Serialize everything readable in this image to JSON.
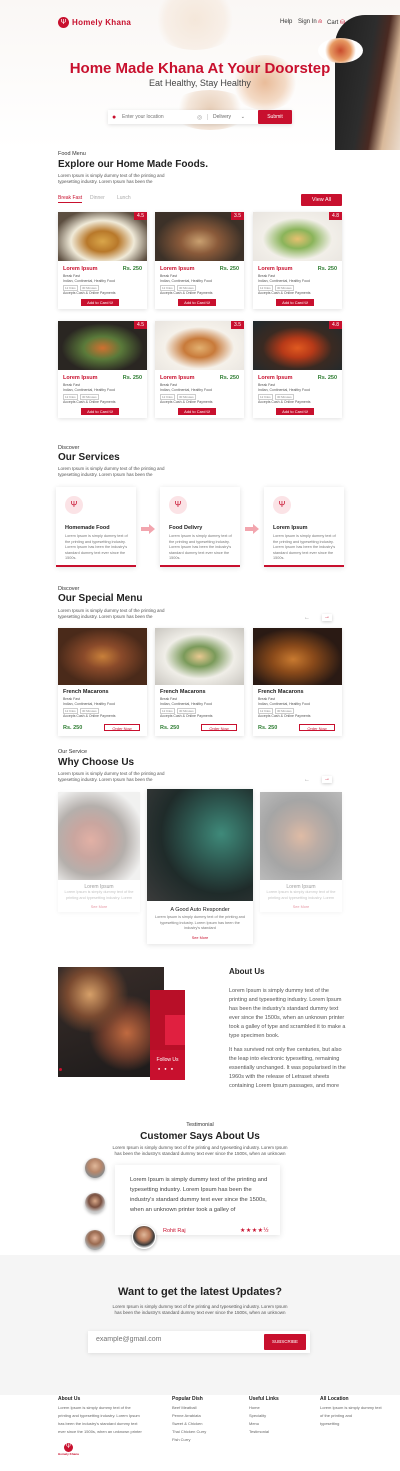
{
  "brand": {
    "name": "Homely Khana",
    "accent": "#c8102e",
    "price_color": "#2e7d32"
  },
  "nav": {
    "help": "Help",
    "signin": "Sign In",
    "cart": "Cart"
  },
  "hero": {
    "title": "Home Made Khana At Your Doorstep",
    "subtitle": "Eat Healthy, Stay Healthy",
    "search_placeholder": "Enter your location",
    "select": "Delivery",
    "submit": "Submit"
  },
  "menu": {
    "label": "Food Menu",
    "title": "Explore our Home Made Foods.",
    "desc1": "Lorem Ipsum is simply dummy text of the printing and",
    "desc2": "typesetting industry. Lorem Ipsum has been the",
    "tabs": [
      "Break Fast",
      "Dinner",
      "Lunch"
    ],
    "view_all": "View All",
    "items": [
      {
        "rating": "4.5",
        "title": "Lorem Ipsum",
        "price": "Rs. 250"
      },
      {
        "rating": "3.5",
        "title": "Lorem Ipsum",
        "price": "Rs. 250"
      },
      {
        "rating": "4.8",
        "title": "Lorem Ipsum",
        "price": "Rs. 250"
      },
      {
        "rating": "4.5",
        "title": "Lorem Ipsum",
        "price": "Rs. 250"
      },
      {
        "rating": "3.5",
        "title": "Lorem Ipsum",
        "price": "Rs. 250"
      },
      {
        "rating": "4.8",
        "title": "Lorem Ipsum",
        "price": "Rs. 250"
      }
    ],
    "meta1": "Break Fast",
    "meta2": "Indian, Continental, Healthy Food",
    "chip1": "12 Kilos",
    "chip2": "30 Minutes",
    "meta3": "Accepts Cash & Online Payments",
    "add": "Add to Card"
  },
  "services": {
    "label": "Discover",
    "title": "Our Services",
    "desc1": "Lorem Ipsum is simply dummy text of the printing and",
    "desc2": "typesetting industry. Lorem Ipsum has been the",
    "items": [
      {
        "title": "Homemade Food",
        "desc": "Lorem Ipsum is simply dummy text of the printing and typesetting industry. Lorem Ipsum has been the industry's standard dummy text ever since the 1500s."
      },
      {
        "title": "Food Delivry",
        "desc": "Lorem Ipsum is simply dummy text of the printing and typesetting industry. Lorem Ipsum has been the industry's standard dummy text ever since the 1500s."
      },
      {
        "title": "Lorem Ipsum",
        "desc": "Lorem Ipsum is simply dummy text of the printing and typesetting industry. Lorem Ipsum has been the industry's standard dummy text ever since the 1500s."
      }
    ]
  },
  "special": {
    "label": "Discover",
    "title": "Our Special Menu",
    "desc1": "Lorem Ipsum is simply dummy text of the printing and",
    "desc2": "typesetting industry. Lorem Ipsum has been the",
    "items": [
      {
        "title": "French Macarons",
        "price": "Rs. 250"
      },
      {
        "title": "French Macarons",
        "price": "Rs. 250"
      },
      {
        "title": "French Macarons",
        "price": "Rs. 250"
      }
    ],
    "order": "Order Now"
  },
  "why": {
    "label": "Our Service",
    "title": "Why Choose Us",
    "desc1": "Lorem Ipsum is simply dummy text of the printing and",
    "desc2": "typesetting industry. Lorem Ipsum has been the",
    "side_title": "Lorem Ipsum",
    "side_desc": "Lorem Ipsum is simply dummy text of the printing and typesetting industry. Lorem",
    "center_title": "A Good Auto Responder",
    "center_desc": "Lorem Ipsum is simply dummy text of the printing and typesetting industry. Lorem Ipsum has been the industry's standard",
    "more": "See More"
  },
  "about": {
    "title": "About Us",
    "p1": "Lorem Ipsum is simply dummy text of the printing and typesetting industry. Lorem Ipsum has been the industry's standard dummy text ever since the 1500s, when an unknown printer took a galley of type and scrambled it to make a type specimen book.",
    "p2": "It has survived not only five centuries, but also the leap into electronic typesetting, remaining essentially unchanged. It was popularised in the 1960s with the release of Letraset sheets containing Lorem Ipsum passages, and more",
    "follow": "Follow Us"
  },
  "testimonial": {
    "label": "Testimonial",
    "title": "Customer Says About Us",
    "desc1": "Lorem Ipsum is simply dummy text of the printing and typesetting industry. Lorem Ipsum",
    "desc2": "has been the industry's standard dummy text ever since the 1500s, when an unknown",
    "quote": "Lorem Ipsum is simply dummy text of the printing and typesetting industry. Lorem Ipsum has been the industry's standard dummy text ever since the 1500s, when an unknown printer took a galley of",
    "name": "Rohit Raj",
    "stars": "★★★★½"
  },
  "newsletter": {
    "title": "Want to get the latest Updates?",
    "desc1": "Lorem Ipsum is simply dummy text of the printing and typesetting industry. Lorem Ipsum",
    "desc2": "has been the industry's standard dummy text ever since the 1500s, when an unknown",
    "placeholder": "example@gmail.com",
    "button": "SUBSCRIBE"
  },
  "footer": {
    "about_h": "About Us",
    "about_t": [
      "Lorem Ipsum is simply dummy text of the",
      "printing and typesetting industry. Lorem Ipsum",
      "has been the industry's standard dummy text",
      "ever since the 1500s, when an unknown printer"
    ],
    "dish_h": "Popular Dish",
    "dish": [
      "Beef Meatball",
      "Penne Arrabiata",
      "Sweet & Chicken",
      "Thai Chicken Curry",
      "Fish Curry"
    ],
    "links_h": "Useful Links",
    "links": [
      "Home",
      "Speciality",
      "Menu",
      "Testimonial"
    ],
    "loc_h": "All Location",
    "loc_t": [
      "Lorem Ipsum is simply dummy text",
      "of the printing and",
      "typesetting"
    ]
  }
}
